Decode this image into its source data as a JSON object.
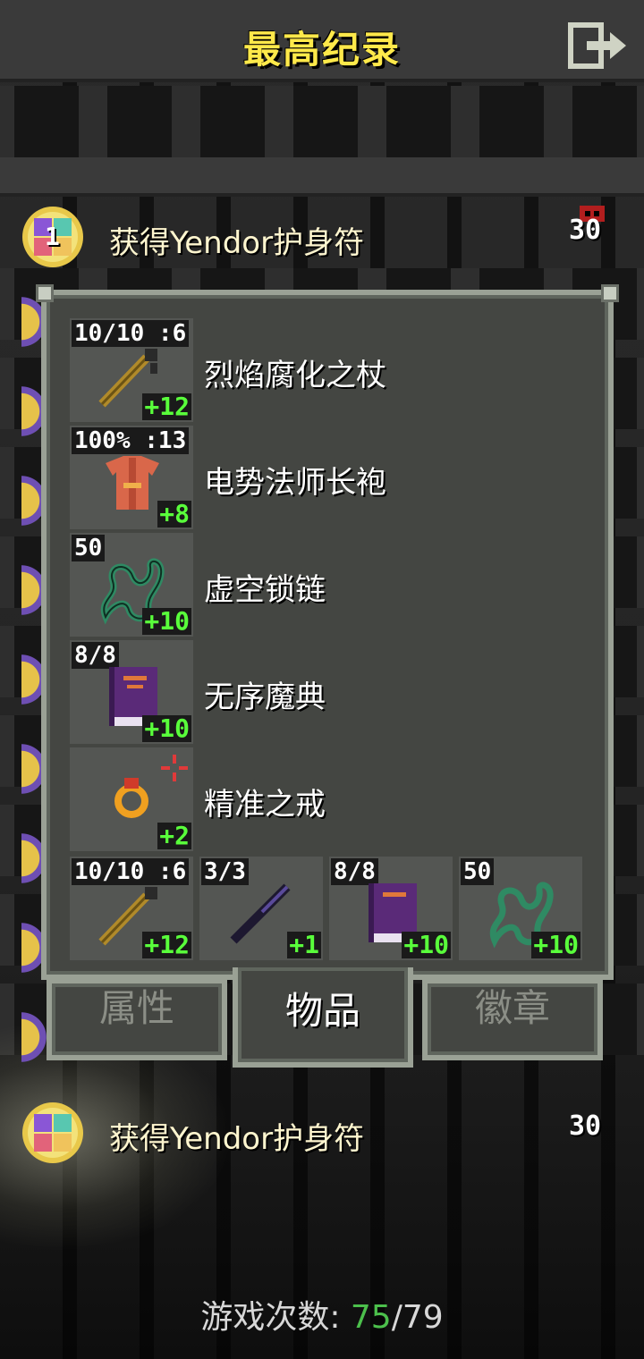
{
  "screen": {
    "title": "最高纪录"
  },
  "records": [
    {
      "rank": "1",
      "description": "获得Yendor护身符",
      "depth": "30"
    },
    {
      "description": "获得Yendor护身符",
      "depth": "30"
    }
  ],
  "items": {
    "equipped": [
      {
        "name": "烈焰腐化之杖",
        "top_label": "10/10 :6",
        "level": "+12",
        "icon": "wand-icon"
      },
      {
        "name": "电势法师长袍",
        "top_label": "100% :13",
        "level": "+8",
        "icon": "robe-icon"
      },
      {
        "name": "虚空锁链",
        "top_label": "50",
        "level": "+10",
        "icon": "chains-icon"
      },
      {
        "name": "无序魔典",
        "top_label": "8/8",
        "level": "+10",
        "icon": "spellbook-icon"
      },
      {
        "name": "精准之戒",
        "top_label": "",
        "level": "+2",
        "icon": "ring-icon"
      }
    ],
    "quickslots": [
      {
        "top_label": "10/10 :6",
        "level": "+12",
        "icon": "wand-icon"
      },
      {
        "top_label": "3/3",
        "level": "+1",
        "icon": "dark-wand-icon"
      },
      {
        "top_label": "8/8",
        "level": "+10",
        "icon": "spellbook-icon"
      },
      {
        "top_label": "50",
        "level": "+10",
        "icon": "chains-icon"
      }
    ]
  },
  "tabs": [
    {
      "label": "属性",
      "active": false
    },
    {
      "label": "物品",
      "active": true
    },
    {
      "label": "徽章",
      "active": false
    }
  ],
  "footer": {
    "label": "游戏次数:",
    "won": "75",
    "separator": "/",
    "total": "79"
  },
  "colors": {
    "title": "#ffe94a",
    "level": "#59ff3b",
    "panel": "#444642",
    "panel_border": "#9aa195",
    "won": "#4cc04c"
  }
}
